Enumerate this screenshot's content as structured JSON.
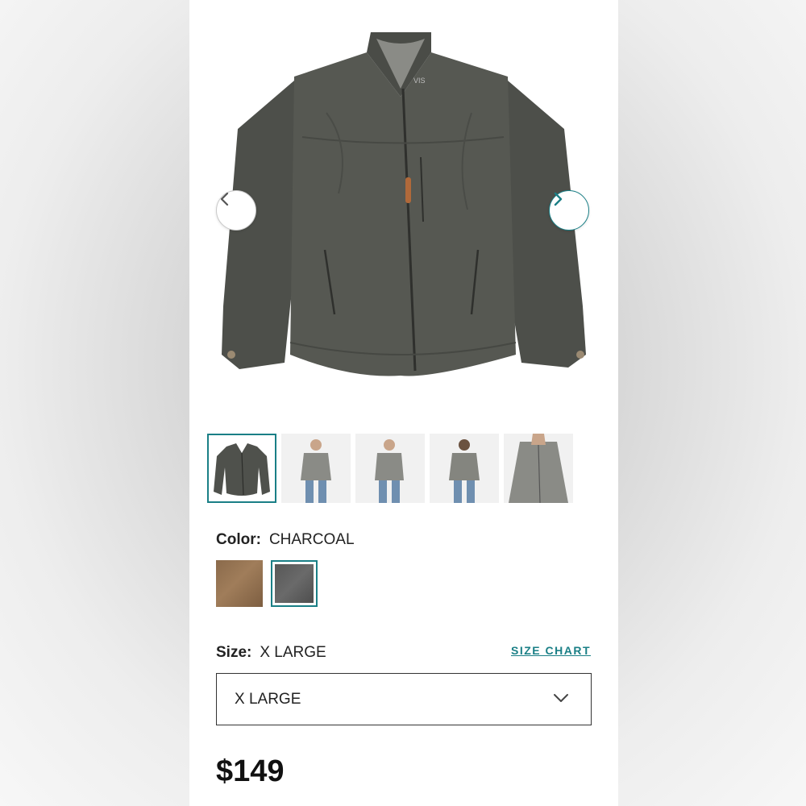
{
  "product": {
    "brand_tag": "VIS",
    "thumbnails": [
      {
        "name": "thumb-flat",
        "active": true
      },
      {
        "name": "thumb-model-front",
        "active": false
      },
      {
        "name": "thumb-model-angle",
        "active": false
      },
      {
        "name": "thumb-model-back",
        "active": false
      },
      {
        "name": "thumb-model-detail",
        "active": false
      }
    ],
    "color_label": "Color:",
    "color_value": "CHARCOAL",
    "colors": [
      {
        "name": "brown",
        "hex": "#8f6e4e",
        "selected": false
      },
      {
        "name": "charcoal",
        "hex": "#5d5d5d",
        "selected": true
      }
    ],
    "size_label": "Size:",
    "size_value": "X LARGE",
    "size_chart_link": "SIZE CHART",
    "size_select_value": "X LARGE",
    "price": "$149"
  },
  "icons": {
    "prev": "chevron-left-icon",
    "next": "chevron-right-icon",
    "dropdown": "chevron-down-icon"
  },
  "colors": {
    "accent": "#1a7f86",
    "jacket": "#545650"
  }
}
